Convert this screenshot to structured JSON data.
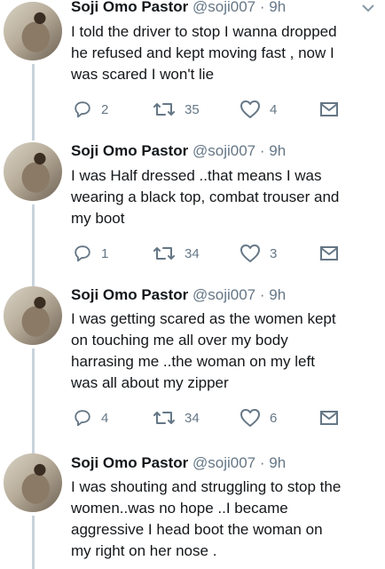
{
  "tweets": [
    {
      "name": "Soji Omo Pastor",
      "handle": "@soji007",
      "time": "· 9h",
      "text_lines": [
        "I told the driver to stop I wanna dropped",
        "he refused and kept moving fast , now I",
        "was scared I won't lie"
      ],
      "replies": "2",
      "retweets": "35",
      "likes": "4"
    },
    {
      "name": "Soji Omo Pastor",
      "handle": "@soji007",
      "time": "· 9h",
      "text_lines": [
        "I was Half dressed ..that means I was",
        "wearing a black top, combat trouser and",
        "my boot"
      ],
      "replies": "1",
      "retweets": "34",
      "likes": "3"
    },
    {
      "name": "Soji Omo Pastor",
      "handle": "@soji007",
      "time": "· 9h",
      "text_lines": [
        "I was getting scared as the women kept",
        "on touching me all over my body",
        "harrasing me ..the woman on my left",
        "was all about my zipper"
      ],
      "replies": "4",
      "retweets": "34",
      "likes": "6"
    },
    {
      "name": "Soji Omo Pastor",
      "handle": "@soji007",
      "time": "· 9h",
      "text_lines": [
        "I was shouting and struggling to stop the",
        "women..was no hope ..I became",
        "aggressive I head boot the woman on",
        "my right on her nose ."
      ]
    }
  ],
  "icons": {
    "reply": "reply-icon",
    "retweet": "retweet-icon",
    "like": "heart-icon",
    "share": "share-mail-icon",
    "menu": "chevron-down-icon"
  },
  "colors": {
    "icon": "#657786",
    "thread_line": "#c9d3dc",
    "text": "#14171a"
  }
}
